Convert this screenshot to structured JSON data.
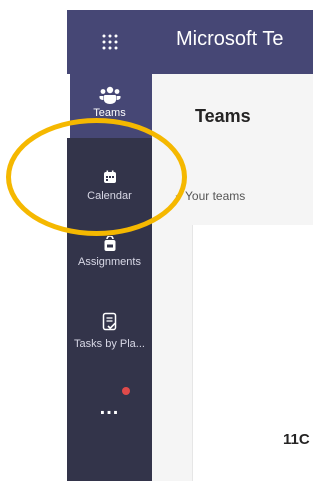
{
  "titlebar": {
    "app_title": "Microsoft Te"
  },
  "rail": {
    "items": [
      {
        "label": "Teams",
        "icon": "teams-icon"
      },
      {
        "label": "Calendar",
        "icon": "calendar-icon"
      },
      {
        "label": "Assignments",
        "icon": "assignments-icon"
      },
      {
        "label": "Tasks by Pla...",
        "icon": "tasks-icon"
      },
      {
        "label": "...",
        "icon": "more-icon"
      }
    ]
  },
  "header": {
    "title": "Teams"
  },
  "teams": {
    "section_label": "Your teams",
    "partial_text": "11C"
  },
  "colors": {
    "accent": "#464775",
    "rail": "#33344a",
    "highlight": "#f5b800",
    "badge": "#e04a4a"
  }
}
